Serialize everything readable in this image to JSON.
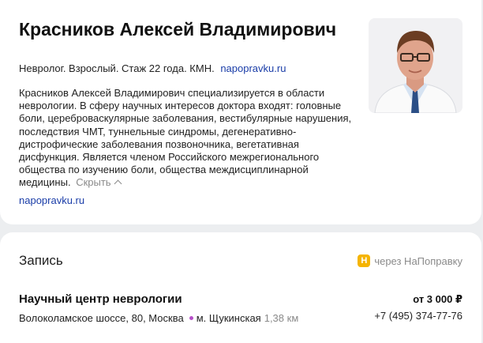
{
  "doctor": {
    "name": "Красников Алексей Владимирович",
    "meta": "Невролог. Взрослый. Стаж 22 года. КМН.",
    "meta_link": "napopravku.ru",
    "description": "Красников Алексей Владимирович специализируется в области неврологии. В сферу научных интересов доктора входят: головные боли, цереброваскулярные заболевания, вестибулярные нарушения, последствия ЧМТ, туннельные синдромы, дегенеративно-дистрофические заболевания позвоночника, вегетативная дисфункция. Является членом Российского межрегионального общества по изучению боли, общества междисциплинарной медицины.",
    "collapse_label": "Скрыть",
    "source_link": "napopravku.ru"
  },
  "booking": {
    "title": "Запись",
    "provider_badge": "Н",
    "provider_label": "через НаПоправку",
    "clinic_name": "Научный центр неврологии",
    "price": "от 3 000 ₽",
    "address": "Волоколамское шоссе, 80, Москва",
    "metro": "м. Щукинская",
    "distance": "1,38 км",
    "phone": "+7 (495) 374-77-76"
  },
  "colors": {
    "link": "#1a3da8",
    "metro_line": "#b54fc8",
    "provider_badge": "#f5b400",
    "muted": "#8a8a8a"
  }
}
